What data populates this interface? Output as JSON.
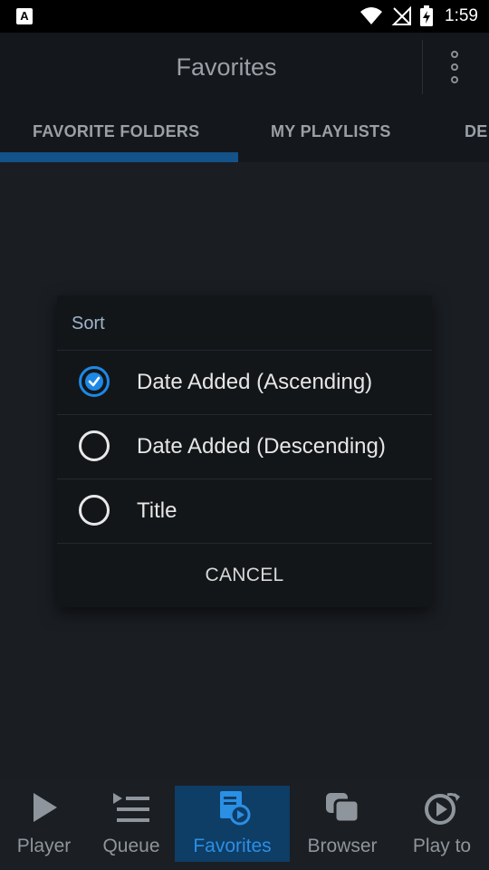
{
  "status_bar": {
    "time": "1:59",
    "left_icon": "A"
  },
  "app_bar": {
    "title": "Favorites",
    "overflow_icon": "more-vert-icon"
  },
  "tabs": [
    {
      "label": "FAVORITE FOLDERS",
      "selected": true
    },
    {
      "label": "MY PLAYLISTS",
      "selected": false
    },
    {
      "label": "DE",
      "selected": false
    }
  ],
  "dialog": {
    "title": "Sort",
    "options": [
      {
        "label": "Date Added (Ascending)",
        "checked": true
      },
      {
        "label": "Date Added (Descending)",
        "checked": false
      },
      {
        "label": "Title",
        "checked": false
      }
    ],
    "cancel_label": "CANCEL"
  },
  "bottom_nav": [
    {
      "label": "Player",
      "icon": "play-icon",
      "active": false
    },
    {
      "label": "Queue",
      "icon": "queue-icon",
      "active": false
    },
    {
      "label": "Favorites",
      "icon": "favorites-icon",
      "active": true
    },
    {
      "label": "Browser",
      "icon": "browser-icon",
      "active": false
    },
    {
      "label": "Play to",
      "icon": "play-to-icon",
      "active": false
    }
  ],
  "colors": {
    "accent": "#1e88e5",
    "tab_indicator": "#14528a",
    "active_nav_bg": "#0e3d66"
  }
}
